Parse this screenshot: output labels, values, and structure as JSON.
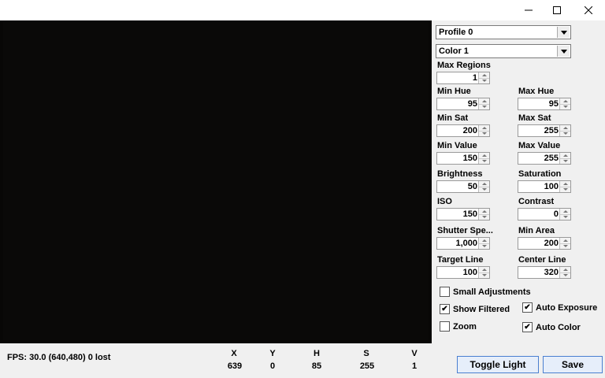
{
  "window": {
    "minimize_icon": "minimize-icon",
    "maximize_icon": "maximize-icon",
    "close_icon": "close-icon"
  },
  "controls": {
    "profile_select": "Profile 0",
    "color_select": "Color 1",
    "max_regions": {
      "label": "Max Regions",
      "value": "1"
    },
    "min_hue": {
      "label": "Min Hue",
      "value": "95"
    },
    "max_hue": {
      "label": "Max Hue",
      "value": "95"
    },
    "min_sat": {
      "label": "Min Sat",
      "value": "200"
    },
    "max_sat": {
      "label": "Max Sat",
      "value": "255"
    },
    "min_value": {
      "label": "Min Value",
      "value": "150"
    },
    "max_value": {
      "label": "Max Value",
      "value": "255"
    },
    "brightness": {
      "label": "Brightness",
      "value": "50"
    },
    "saturation": {
      "label": "Saturation",
      "value": "100"
    },
    "iso": {
      "label": "ISO",
      "value": "150"
    },
    "contrast": {
      "label": "Contrast",
      "value": "0"
    },
    "shutter_speed": {
      "label": "Shutter Spe...",
      "value": "1,000"
    },
    "min_area": {
      "label": "Min Area",
      "value": "200"
    },
    "target_line": {
      "label": "Target Line",
      "value": "100"
    },
    "center_line": {
      "label": "Center Line",
      "value": "320"
    }
  },
  "checkboxes": {
    "small_adjustments": {
      "label": "Small Adjustments",
      "checked": false
    },
    "show_filtered": {
      "label": "Show Filtered",
      "checked": true
    },
    "auto_exposure": {
      "label": "Auto Exposure",
      "checked": true
    },
    "zoom": {
      "label": "Zoom",
      "checked": false
    },
    "auto_color": {
      "label": "Auto Color",
      "checked": true
    },
    "check_mark": "✔"
  },
  "status": {
    "fps": "FPS: 30.0 (640,480) 0 lost"
  },
  "pixel_info": {
    "headers": [
      "X",
      "Y",
      "H",
      "S",
      "V"
    ],
    "values": [
      "639",
      "0",
      "85",
      "255",
      "1"
    ]
  },
  "buttons": {
    "toggle_light": "Toggle Light",
    "save": "Save"
  }
}
